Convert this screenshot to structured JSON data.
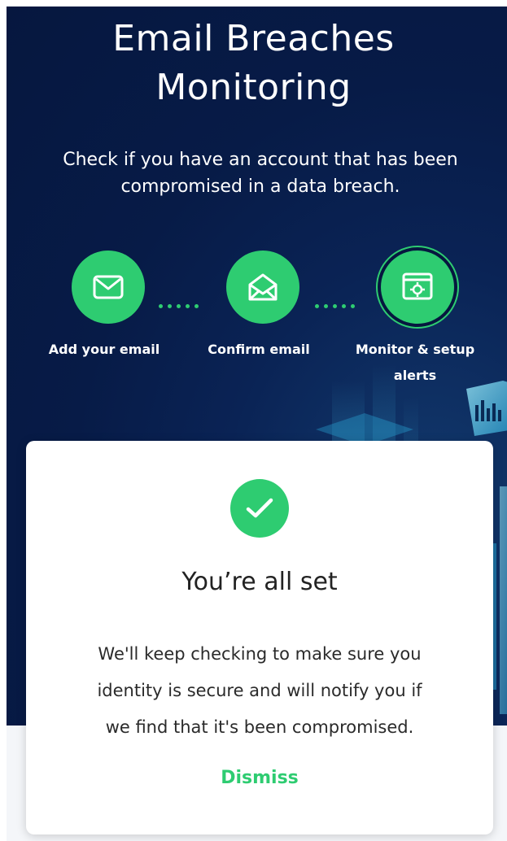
{
  "header": {
    "title_line1": "Email Breaches",
    "title_line2": "Monitoring",
    "subtitle_line1": "Check if you have an account that has been",
    "subtitle_line2": "compromised in a data breach."
  },
  "steps": [
    {
      "label": "Add your email",
      "icon": "mail-icon"
    },
    {
      "label": "Confirm email",
      "icon": "open-envelope-icon"
    },
    {
      "label_line1": "Monitor & setup",
      "label_line2": "alerts",
      "icon": "browser-gear-icon",
      "active": true
    }
  ],
  "modal": {
    "title": "You’re all set",
    "body_line1": "We'll keep checking to make sure you",
    "body_line2": "identity is secure and will notify you if",
    "body_line3": "we find that it's been compromised.",
    "dismiss_label": "Dismiss",
    "icon": "check-circle-icon"
  },
  "colors": {
    "accent": "#2ecc71",
    "hero_background": "#06173f",
    "card_background": "#ffffff"
  }
}
